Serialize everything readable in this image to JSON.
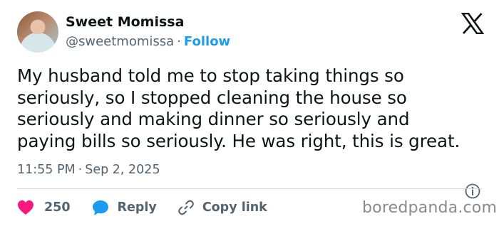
{
  "author": {
    "name": "Sweet Momissa",
    "handle": "@sweetmomissa",
    "separator": "·",
    "follow_label": "Follow"
  },
  "tweet": {
    "lines": [
      "My husband told me to stop taking things so",
      "seriously, so I stopped cleaning the house so",
      "seriously and making dinner so seriously and",
      "paying bills so seriously. He was right, this is great."
    ],
    "time": "11:55 PM",
    "separator": "·",
    "date": "Sep 2, 2025"
  },
  "actions": {
    "like_count": "250",
    "reply_label": "Reply",
    "copy_label": "Copy link"
  },
  "watermark": "boredpanda.com",
  "icons": {
    "platform": "x-logo-icon",
    "info": "info-icon",
    "like": "heart-icon",
    "reply": "speech-bubble-icon",
    "copy": "link-icon"
  },
  "colors": {
    "accent": "#1d9bf0",
    "heart": "#f91880",
    "text": "#0f1419",
    "secondary": "#536471"
  }
}
